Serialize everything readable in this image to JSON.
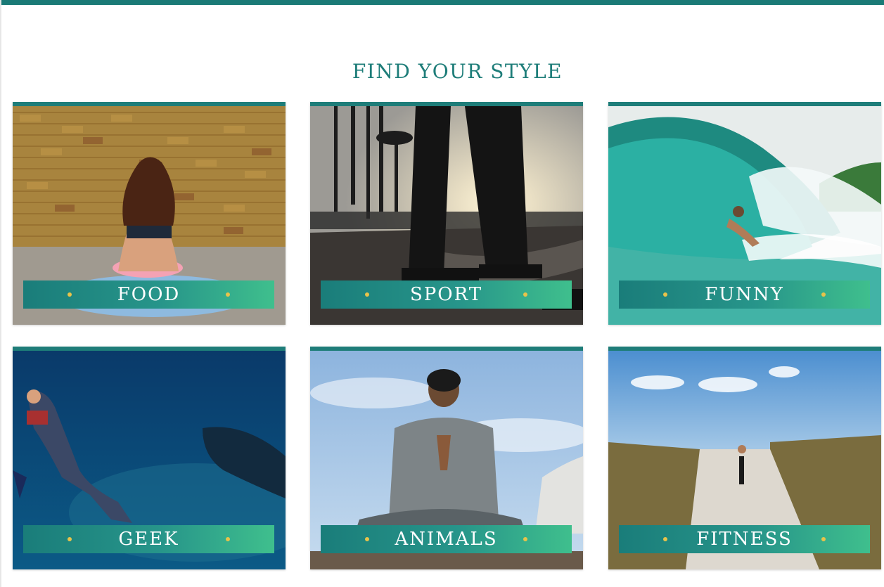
{
  "section": {
    "title": "FIND YOUR STYLE"
  },
  "categories": [
    {
      "label": "FOOD",
      "scene": "yoga-woman-brick-wall"
    },
    {
      "label": "SPORT",
      "scene": "skatepark-sunset"
    },
    {
      "label": "FUNNY",
      "scene": "surfer-wave"
    },
    {
      "label": "GEEK",
      "scene": "diver-whale-shark"
    },
    {
      "label": "ANIMALS",
      "scene": "man-meditating-sky"
    },
    {
      "label": "FITNESS",
      "scene": "beach-path-dunes"
    }
  ],
  "colors": {
    "accent": "#1e7d79",
    "label_gradient_start": "#1a7d7a",
    "label_gradient_end": "#3fbf8d",
    "dot": "#e8c34a"
  }
}
